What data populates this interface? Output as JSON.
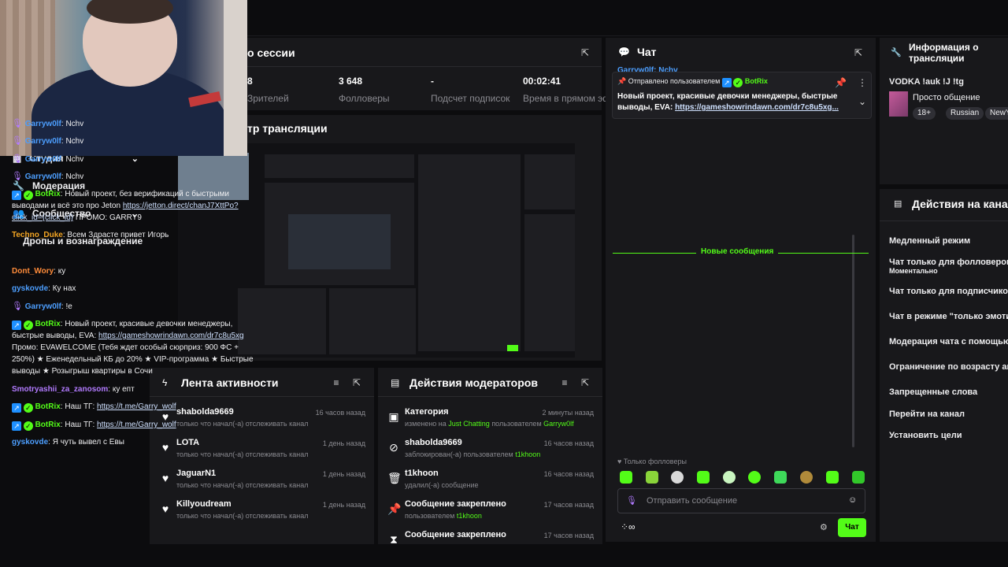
{
  "sidebar": {
    "items": [
      {
        "label": "Студия",
        "icon": "studio-icon",
        "has_chevron": true
      },
      {
        "label": "Модерация",
        "icon": "wrench-icon",
        "has_chevron": false
      },
      {
        "label": "Сообщество",
        "icon": "community-icon",
        "has_chevron": true
      },
      {
        "label": "Дропы и вознаграждение",
        "icon": "",
        "has_chevron": false
      }
    ]
  },
  "session": {
    "title": "о сессии",
    "stats": [
      {
        "value": "8",
        "label": "Зрителей"
      },
      {
        "value": "3 648",
        "label": "Фолловеры"
      },
      {
        "value": "-",
        "label": "Подсчет подписок"
      },
      {
        "value": "00:02:41",
        "label": "Время в прямом эфире"
      }
    ]
  },
  "preview": {
    "title": "тр трансляции"
  },
  "feed": {
    "title": "Лента активности",
    "items": [
      {
        "name": "shabolda9669",
        "sub": "только что начал(-а) отслеживать канал",
        "time": "16 часов назад"
      },
      {
        "name": "LOTA",
        "sub": "только что начал(-а) отслеживать канал",
        "time": "1 день назад"
      },
      {
        "name": "JaguarN1",
        "sub": "только что начал(-а) отслеживать канал",
        "time": "1 день назад"
      },
      {
        "name": "Killyoudream",
        "sub": "только что начал(-а) отслеживать канал",
        "time": "1 день назад"
      }
    ]
  },
  "modlog": {
    "title": "Действия модераторов",
    "items": [
      {
        "name": "Категория",
        "sub_prefix": "изменено на ",
        "sub_highlight": "Just Chatting",
        "sub_mid": " пользователем ",
        "sub_user": "Garryw0lf",
        "time": "2 минуты назад",
        "icon": "category-icon"
      },
      {
        "name": "shabolda9669",
        "sub_prefix": "заблокирован(-а) пользователем ",
        "sub_highlight": "",
        "sub_mid": "",
        "sub_user": "t1khoon",
        "time": "16 часов назад",
        "icon": "ban-icon"
      },
      {
        "name": "t1khoon",
        "sub_prefix": "удалил(-а) сообщение",
        "sub_highlight": "",
        "sub_mid": "",
        "sub_user": "",
        "time": "16 часов назад",
        "icon": "trash-icon"
      },
      {
        "name": "Сообщение закреплено",
        "sub_prefix": "пользователем ",
        "sub_highlight": "",
        "sub_mid": "",
        "sub_user": "t1khoon",
        "time": "17 часов назад",
        "icon": "pin-icon"
      },
      {
        "name": "Сообщение закреплено",
        "sub_prefix": "",
        "sub_highlight": "",
        "sub_mid": "",
        "sub_user": "",
        "time": "17 часов назад",
        "icon": "hourglass-icon"
      }
    ]
  },
  "chat": {
    "title": "Чат",
    "top_partial": "Garryw0lf: Nchv",
    "pinned": {
      "header": "Отправлено пользователем",
      "user": "BotRix",
      "text": "Новый проект, красивые девочки менеджеры, быстрые выводы, EVA: ",
      "link": "https://gameshowrindawn.com/dr7c8u5xg..."
    },
    "garry_name": "Garryw0lf",
    "garry_lines": [
      "Nchv",
      "Nchv",
      "Nchv",
      "Nchv"
    ],
    "bot_name": "BotRix",
    "bot1_text": "Новый проект, без верификаций с быстрыми выводами и всё это про Jeton ",
    "bot1_link": "https://jetton.direct/chanJ7XttPo?click_id={click_id}",
    "bot1_tail": " ПРОМО: GARRY9",
    "techno_name": "Techno_Duke",
    "techno_text": "Всем Здрасте привет Игорь",
    "new_messages": "Новые сообщения",
    "dont_name": "Dont_Wory",
    "dont_text": "ку",
    "gys_name": "gyskovde",
    "gys_text1": "Ку нах",
    "garry_text2": "!e",
    "bot2_text": "Новый проект, красивые девочки менеджеры, быстрые выводы, EVA: ",
    "bot2_link": "https://gameshowrindawn.com/dr7c8u5xg",
    "bot2_tail": " Промо: EVAWELCOME (Тебя ждет особый сюрприз: 900 ФС + 250%) ★ Еженедельный КБ до 20% ★ VIP-программа ★ Быстрые выводы ★ Розыгрыш квартиры в Сочи",
    "smot_name": "Smotryashii_za_zanosom",
    "smot_text": "ку епт",
    "bot3_text": "Наш ТГ: ",
    "bot3_link": "https://t.me/Garry_wolf",
    "bot4_text": "Наш ТГ: ",
    "bot4_link": "https://t.me/Garry_wolf",
    "gys_text2": "Я чуть вывел с Евы",
    "followers_only": "Только фолловеры",
    "input_placeholder": "Отправить сообщение",
    "send_label": "Чат"
  },
  "info": {
    "title": "Информация о трансляции",
    "stream_title": "VODKA !auk !J !tg",
    "category": "Просто общение",
    "tags": [
      "18+",
      "Russian",
      "NewY"
    ]
  },
  "actions": {
    "title": "Действия на канал",
    "items": [
      {
        "label": "Медленный режим",
        "sub": ""
      },
      {
        "label": "Чат только для фолловеров",
        "sub": "Моментально"
      },
      {
        "label": "Чат только для подписчиков",
        "sub": ""
      },
      {
        "label": "Чат в режиме \"только эмотик",
        "sub": ""
      },
      {
        "label": "Модерация чата с помощью И",
        "sub": ""
      },
      {
        "label": "Ограничение по возрасту акк",
        "sub": ""
      },
      {
        "label": "Запрещенные слова",
        "sub": ""
      },
      {
        "label": "Перейти на канал",
        "sub": ""
      },
      {
        "label": "Установить цели",
        "sub": ""
      }
    ]
  },
  "colors": {
    "accent": "#53fc18",
    "panel": "#18181b",
    "background": "#0c0c0e"
  }
}
